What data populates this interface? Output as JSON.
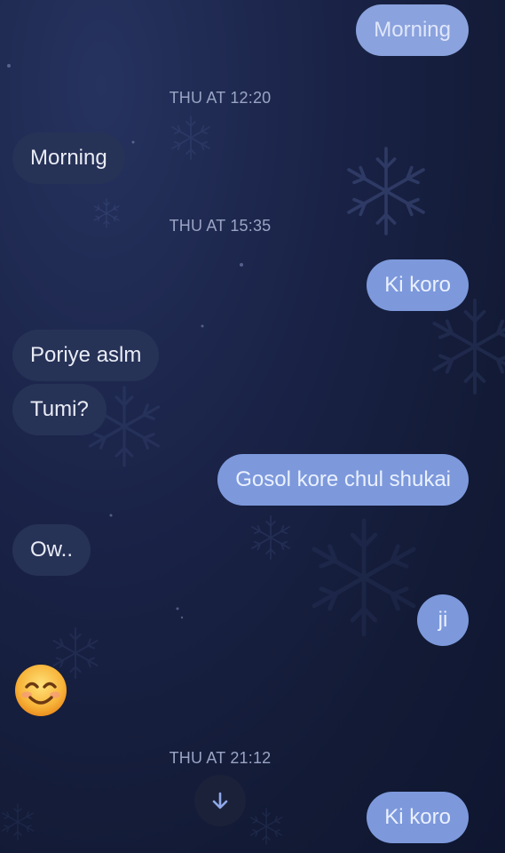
{
  "theme": {
    "outgoing_bubble": "#7d99dc",
    "incoming_bubble": "#273257",
    "timestamp_color": "#9aa4c4",
    "background": "#1a2347"
  },
  "messages": [
    {
      "id": "m1",
      "direction": "outgoing",
      "text": "Morning"
    },
    {
      "id": "t1",
      "type": "timestamp",
      "text": "THU AT 12:20"
    },
    {
      "id": "m2",
      "direction": "incoming",
      "text": "Morning"
    },
    {
      "id": "t2",
      "type": "timestamp",
      "text": "THU AT 15:35"
    },
    {
      "id": "m3",
      "direction": "outgoing",
      "text": "Ki koro"
    },
    {
      "id": "m4",
      "direction": "incoming",
      "text": "Poriye aslm"
    },
    {
      "id": "m5",
      "direction": "incoming",
      "text": "Tumi?"
    },
    {
      "id": "m6",
      "direction": "outgoing",
      "text": "Gosol kore chul shukai"
    },
    {
      "id": "m7",
      "direction": "incoming",
      "text": "Ow.."
    },
    {
      "id": "m8",
      "direction": "outgoing",
      "text": "ji"
    },
    {
      "id": "m9",
      "direction": "incoming",
      "type": "emoji",
      "icon": "smiling-face-emoji"
    },
    {
      "id": "t3",
      "type": "timestamp",
      "text": "THU AT 21:12"
    },
    {
      "id": "m10",
      "direction": "outgoing",
      "text": "Ki koro"
    }
  ],
  "scroll_button": {
    "icon": "arrow-down-icon"
  }
}
